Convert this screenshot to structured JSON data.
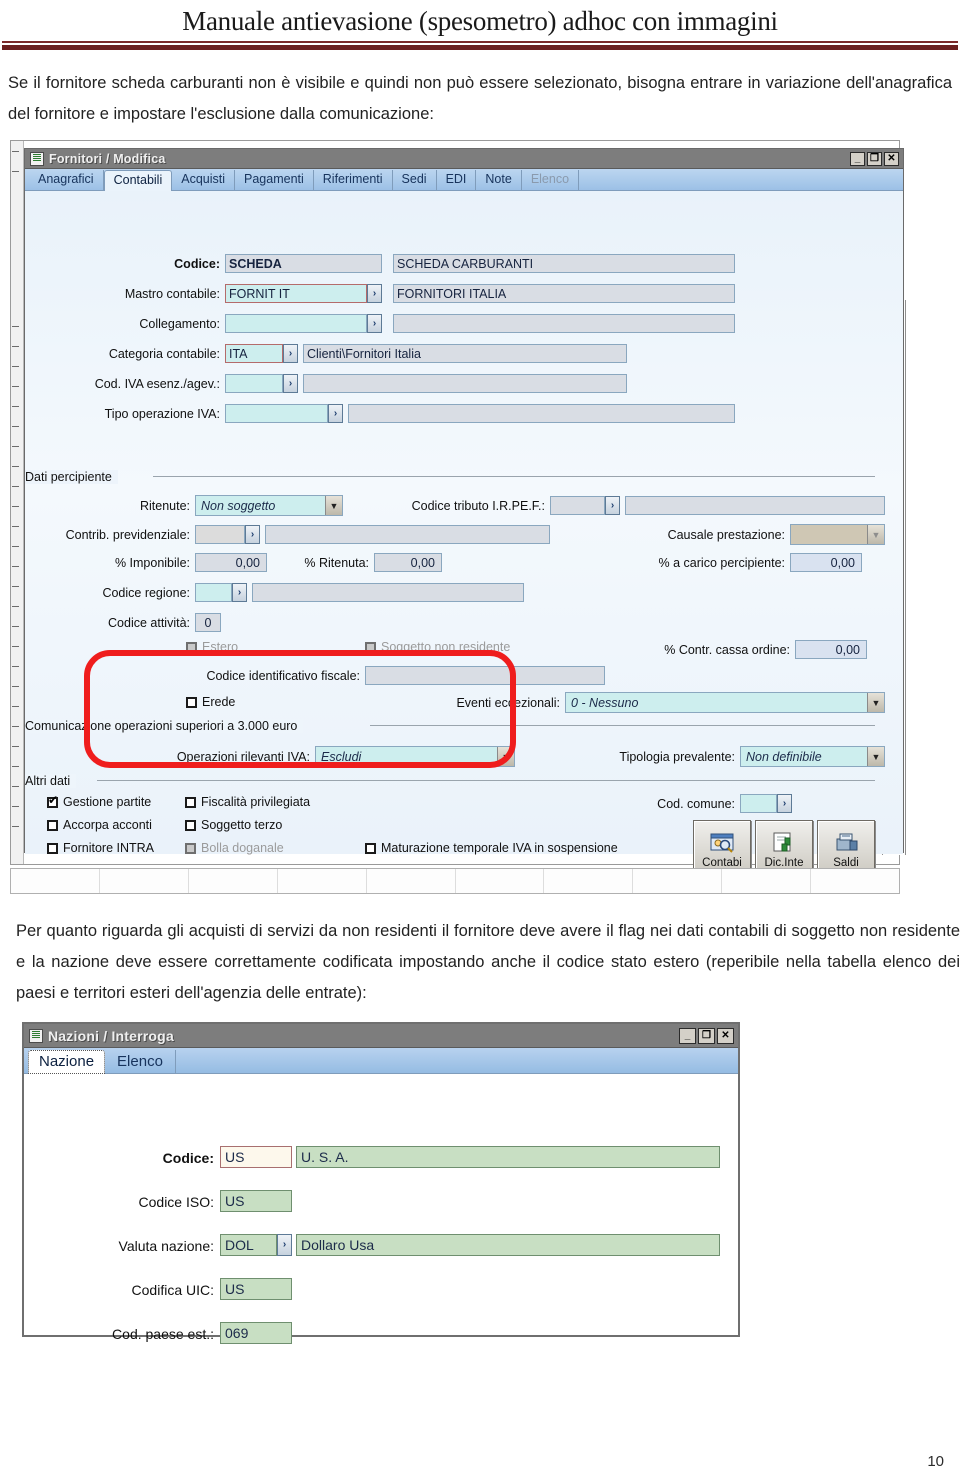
{
  "document": {
    "title": "Manuale antievasione (spesometro) adhoc con immagini",
    "paragraph_1": "Se il fornitore scheda carburanti non è visibile e quindi non può essere selezionato, bisogna entrare in variazione dell'anagrafica del fornitore  e impostare l'esclusione dalla comunicazione:",
    "paragraph_2": "Per quanto riguarda gli acquisti di servizi da non residenti il fornitore deve avere il flag nei dati contabili di soggetto non residente e la nazione deve essere correttamente codificata impostando anche il codice stato estero (reperibile nella tabella elenco dei paesi e territori esteri dell'agenzia delle entrate):",
    "page_number": "10",
    "rule_color": "#6b2020"
  },
  "window_fornitori": {
    "title": "Fornitori / Modifica",
    "title_icon": "document-icon",
    "controls": {
      "minimize": "_",
      "maximize": "❐",
      "close": "✕"
    },
    "tabs": [
      {
        "label": "Anagrafici",
        "active": false,
        "dim": false
      },
      {
        "label": "Contabili",
        "active": true,
        "dim": false
      },
      {
        "label": "Acquisti",
        "active": false,
        "dim": false
      },
      {
        "label": "Pagamenti",
        "active": false,
        "dim": false
      },
      {
        "label": "Riferimenti",
        "active": false,
        "dim": false
      },
      {
        "label": "Sedi",
        "active": false,
        "dim": false
      },
      {
        "label": "EDI",
        "active": false,
        "dim": false
      },
      {
        "label": "Note",
        "active": false,
        "dim": false
      },
      {
        "label": "Elenco",
        "active": false,
        "dim": true
      }
    ],
    "fields": {
      "codice_label": "Codice:",
      "codice_value": "SCHEDA",
      "codice_desc": "SCHEDA CARBURANTI",
      "mastro_label": "Mastro contabile:",
      "mastro_value": "FORNIT IT",
      "mastro_desc": "FORNITORI ITALIA",
      "collegamento_label": "Collegamento:",
      "collegamento_value": "",
      "collegamento_desc": "",
      "categoria_label": "Categoria contabile:",
      "categoria_value": "ITA",
      "categoria_desc": "Clienti\\Fornitori Italia",
      "codiva_label": "Cod. IVA esenz./agev.:",
      "codiva_value": "",
      "codiva_desc": "",
      "tipoop_label": "Tipo operazione IVA:",
      "tipoop_value": "",
      "tipoop_desc": ""
    },
    "dati_percipiente": {
      "group_label": "Dati percipiente",
      "ritenute_label": "Ritenute:",
      "ritenute_value": "Non soggetto",
      "codice_tributo_label": "Codice tributo I.R.PE.F.:",
      "codice_tributo_value": "",
      "codice_tributo_desc": "",
      "contrib_label": "Contrib. previdenziale:",
      "contrib_value": "",
      "contrib_desc": "",
      "causale_label": "Causale prestazione:",
      "causale_value": "",
      "imponibile_label": "% Imponibile:",
      "imponibile_value": "0,00",
      "ritenuta_label": "% Ritenuta:",
      "ritenuta_value": "0,00",
      "carico_label": "% a carico percipiente:",
      "carico_value": "0,00",
      "regione_label": "Codice regione:",
      "regione_value": "",
      "regione_desc": "",
      "attivita_label": "Codice attività:",
      "attivita_value": "0",
      "estero_label": "Estero",
      "soggetto_non_residente_label": "Soggetto non residente",
      "contr_cassa_label": "% Contr. cassa ordine:",
      "contr_cassa_value": "0,00",
      "cif_label": "Codice identificativo fiscale:",
      "cif_value": "",
      "erede_label": "Erede",
      "eventi_label": "Eventi eccezionali:",
      "eventi_value": "0 - Nessuno"
    },
    "comunicazione": {
      "group_label": "Comunicazione operazioni superiori a 3.000 euro",
      "operazioni_label": "Operazioni rilevanti IVA:",
      "operazioni_value": "Escludi",
      "tipologia_label": "Tipologia prevalente:",
      "tipologia_value": "Non definibile"
    },
    "altri_dati": {
      "group_label": "Altri dati",
      "checkboxes": [
        {
          "label": "Gestione partite",
          "checked": true,
          "disabled": false
        },
        {
          "label": "Fiscalità privilegiata",
          "checked": false,
          "disabled": false
        },
        {
          "label": "Accorpa acconti",
          "checked": false,
          "disabled": false
        },
        {
          "label": "Soggetto terzo",
          "checked": false,
          "disabled": false
        },
        {
          "label": "Fornitore INTRA",
          "checked": false,
          "disabled": false
        },
        {
          "label": "Bolla doganale",
          "checked": false,
          "disabled": true
        },
        {
          "label": "Maturazione temporale IVA in sospensione",
          "checked": false,
          "disabled": false
        }
      ],
      "cod_comune_label": "Cod. comune:",
      "cod_comune_value": ""
    },
    "buttons": [
      {
        "label": "Contabi",
        "underline": "C",
        "icon": "contabilita-icon"
      },
      {
        "label": "Dic.Inte",
        "underline": "D",
        "icon": "dichiarazione-intento-icon"
      },
      {
        "label": "Saldi",
        "underline": "S",
        "icon": "saldi-icon"
      }
    ],
    "highlight_color": "#ef1d1d"
  },
  "window_nazioni": {
    "title": "Nazioni / Interroga",
    "title_icon": "document-icon",
    "controls": {
      "minimize": "_",
      "maximize": "❐",
      "close": "✕"
    },
    "tabs": [
      {
        "label": "Nazione",
        "active": true
      },
      {
        "label": "Elenco",
        "active": false
      }
    ],
    "fields": [
      {
        "label": "Codice:",
        "value": "US",
        "desc": "U. S. A.",
        "bold": true,
        "has_arrow": false
      },
      {
        "label": "Codice ISO:",
        "value": "US",
        "desc": "",
        "bold": false,
        "has_arrow": false
      },
      {
        "label": "Valuta nazione:",
        "value": "DOL",
        "desc": "Dollaro Usa",
        "bold": false,
        "has_arrow": true
      },
      {
        "label": "Codifica UIC:",
        "value": "US",
        "desc": "",
        "bold": false,
        "has_arrow": false
      },
      {
        "label": "Cod. paese est.:",
        "value": "069",
        "desc": "",
        "bold": false,
        "has_arrow": false
      }
    ]
  }
}
